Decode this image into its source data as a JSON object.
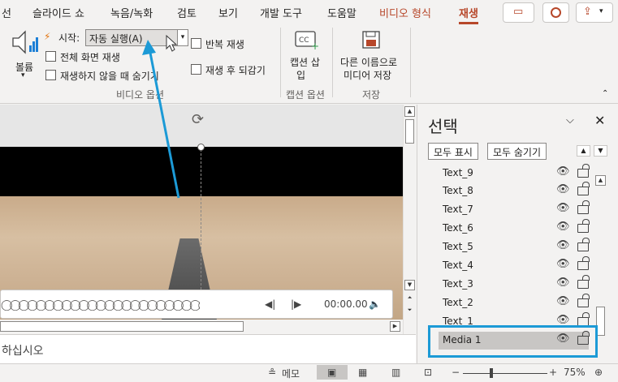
{
  "menu": {
    "tabs": [
      "선",
      "슬라이드 쇼",
      "녹음/녹화",
      "검토",
      "보기",
      "개발 도구",
      "도움말",
      "비디오 형식",
      "재생"
    ]
  },
  "ribbon": {
    "volume_label": "볼륨",
    "start_label": "시작:",
    "start_value": "자동 실행(A)",
    "fullscreen_label": "전체 화면 재생",
    "hide_label": "재생하지 않을 때 숨기기",
    "loop_label": "반복 재생",
    "rewind_label": "재생 후 되감기",
    "group_video_options": "비디오 옵션",
    "caption_label_1": "캡션 삽",
    "caption_label_2": "입",
    "group_caption_options": "캡션 옵션",
    "save_label_1": "다른 이름으로",
    "save_label_2": "미디어 저장",
    "group_save": "저장"
  },
  "player": {
    "time": "00:00.00"
  },
  "notes": {
    "text": "하십시오"
  },
  "selection_pane": {
    "title": "선택",
    "show_all": "모두 표시",
    "hide_all": "모두 숨기기",
    "items": [
      "Text_9",
      "Text_8",
      "Text_7",
      "Text_6",
      "Text_5",
      "Text_4",
      "Text_3",
      "Text_2",
      "Text_1",
      "Media 1"
    ],
    "selected": "Media 1"
  },
  "status": {
    "notes_label": "메모",
    "zoom": "75%"
  },
  "colors": {
    "accent": "#b7472a",
    "callout": "#1c9ad6",
    "selected_row": "#c8c6c4"
  }
}
